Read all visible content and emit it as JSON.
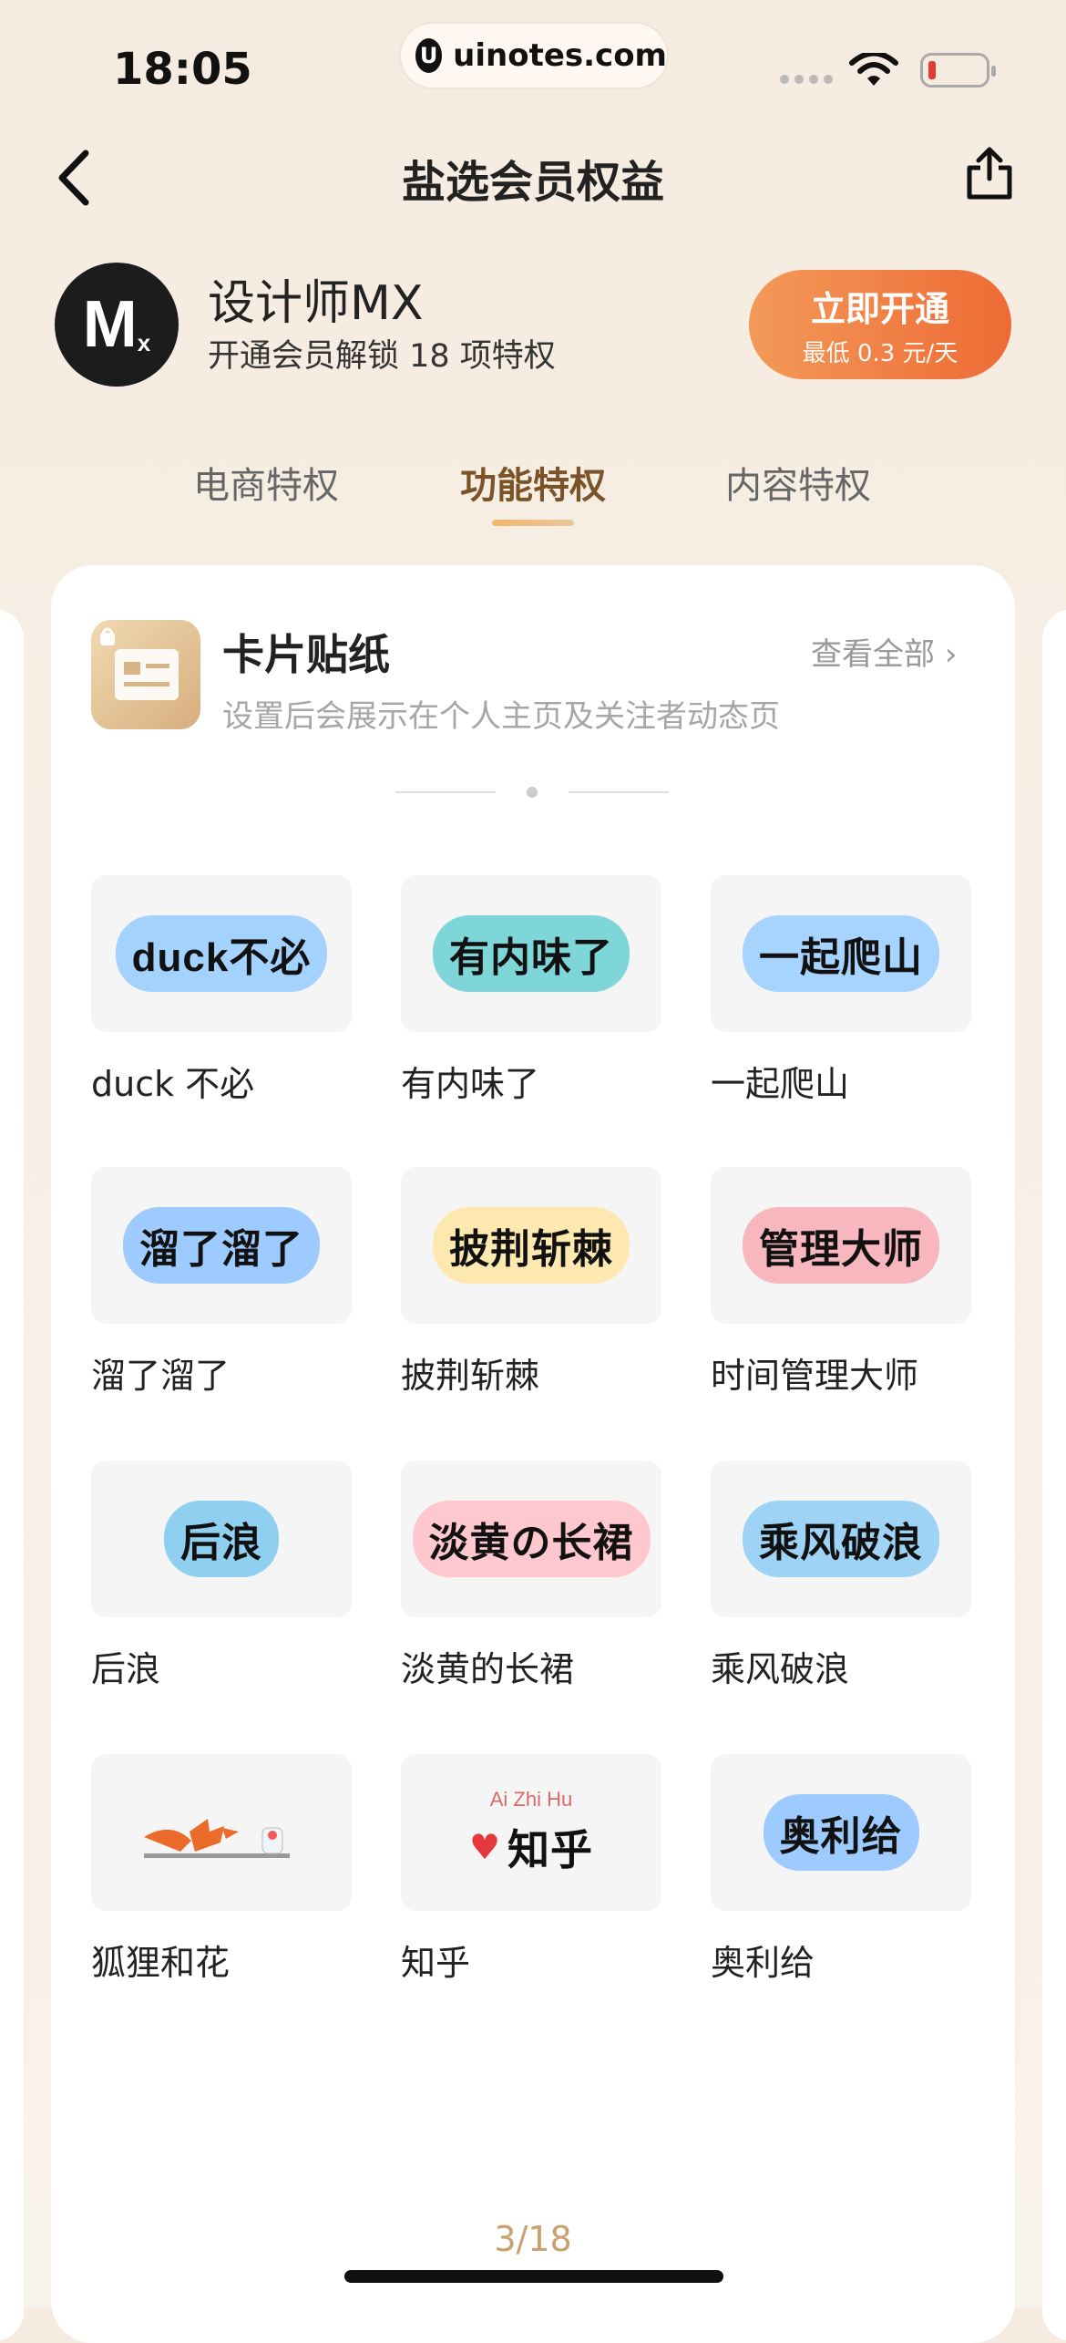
{
  "status_bar": {
    "time": "18:05",
    "url": "uinotes.com",
    "url_logo": "U"
  },
  "nav": {
    "title": "盐选会员权益",
    "back_icon": "chevron-left-icon",
    "share_icon": "share-icon"
  },
  "profile": {
    "avatar_letter": "M",
    "avatar_sub": "x",
    "name": "设计师MX",
    "subtitle": "开通会员解锁 18 项特权",
    "cta_label": "立即开通",
    "cta_sub": "最低 0.3 元/天",
    "cta_colors": [
      "#f39a58",
      "#ee6a35"
    ]
  },
  "tabs": [
    {
      "label": "电商特权",
      "active": false
    },
    {
      "label": "功能特权",
      "active": true
    },
    {
      "label": "内容特权",
      "active": false
    }
  ],
  "feature": {
    "title": "卡片贴纸",
    "view_all": "查看全部",
    "description": "设置后会展示在个人主页及关注者动态页"
  },
  "stickers": [
    {
      "art": "duck不必",
      "label": "duck 不必",
      "bg": "#9fd0ff"
    },
    {
      "art": "有内味了",
      "label": "有内味了",
      "bg": "#7fd6d8"
    },
    {
      "art": "一起爬山",
      "label": "一起爬山",
      "bg": "#a7d3ff"
    },
    {
      "art": "溜了溜了",
      "label": "溜了溜了",
      "bg": "#9ecbff"
    },
    {
      "art": "披荆斩棘",
      "label": "披荆斩棘",
      "bg": "#fde8b0"
    },
    {
      "art": "管理大师",
      "label": "时间管理大师",
      "bg": "#f8b6bf"
    },
    {
      "art": "后浪",
      "label": "后浪",
      "bg": "#8fd0f0"
    },
    {
      "art": "淡黄の长裙",
      "label": "淡黄的长裙",
      "bg": "#ffc8cf"
    },
    {
      "art": "乘风破浪",
      "label": "乘风破浪",
      "bg": "#9fd3f5"
    },
    {
      "art": "",
      "label": "狐狸和花",
      "bg": "#f5f5f5"
    },
    {
      "art": "知乎",
      "label": "知乎",
      "bg": "#f5f5f5",
      "subtext": "Ai  Zhi Hu"
    },
    {
      "art": "奥利给",
      "label": "奥利给",
      "bg": "#9ecbff"
    }
  ],
  "pager": "3/18"
}
